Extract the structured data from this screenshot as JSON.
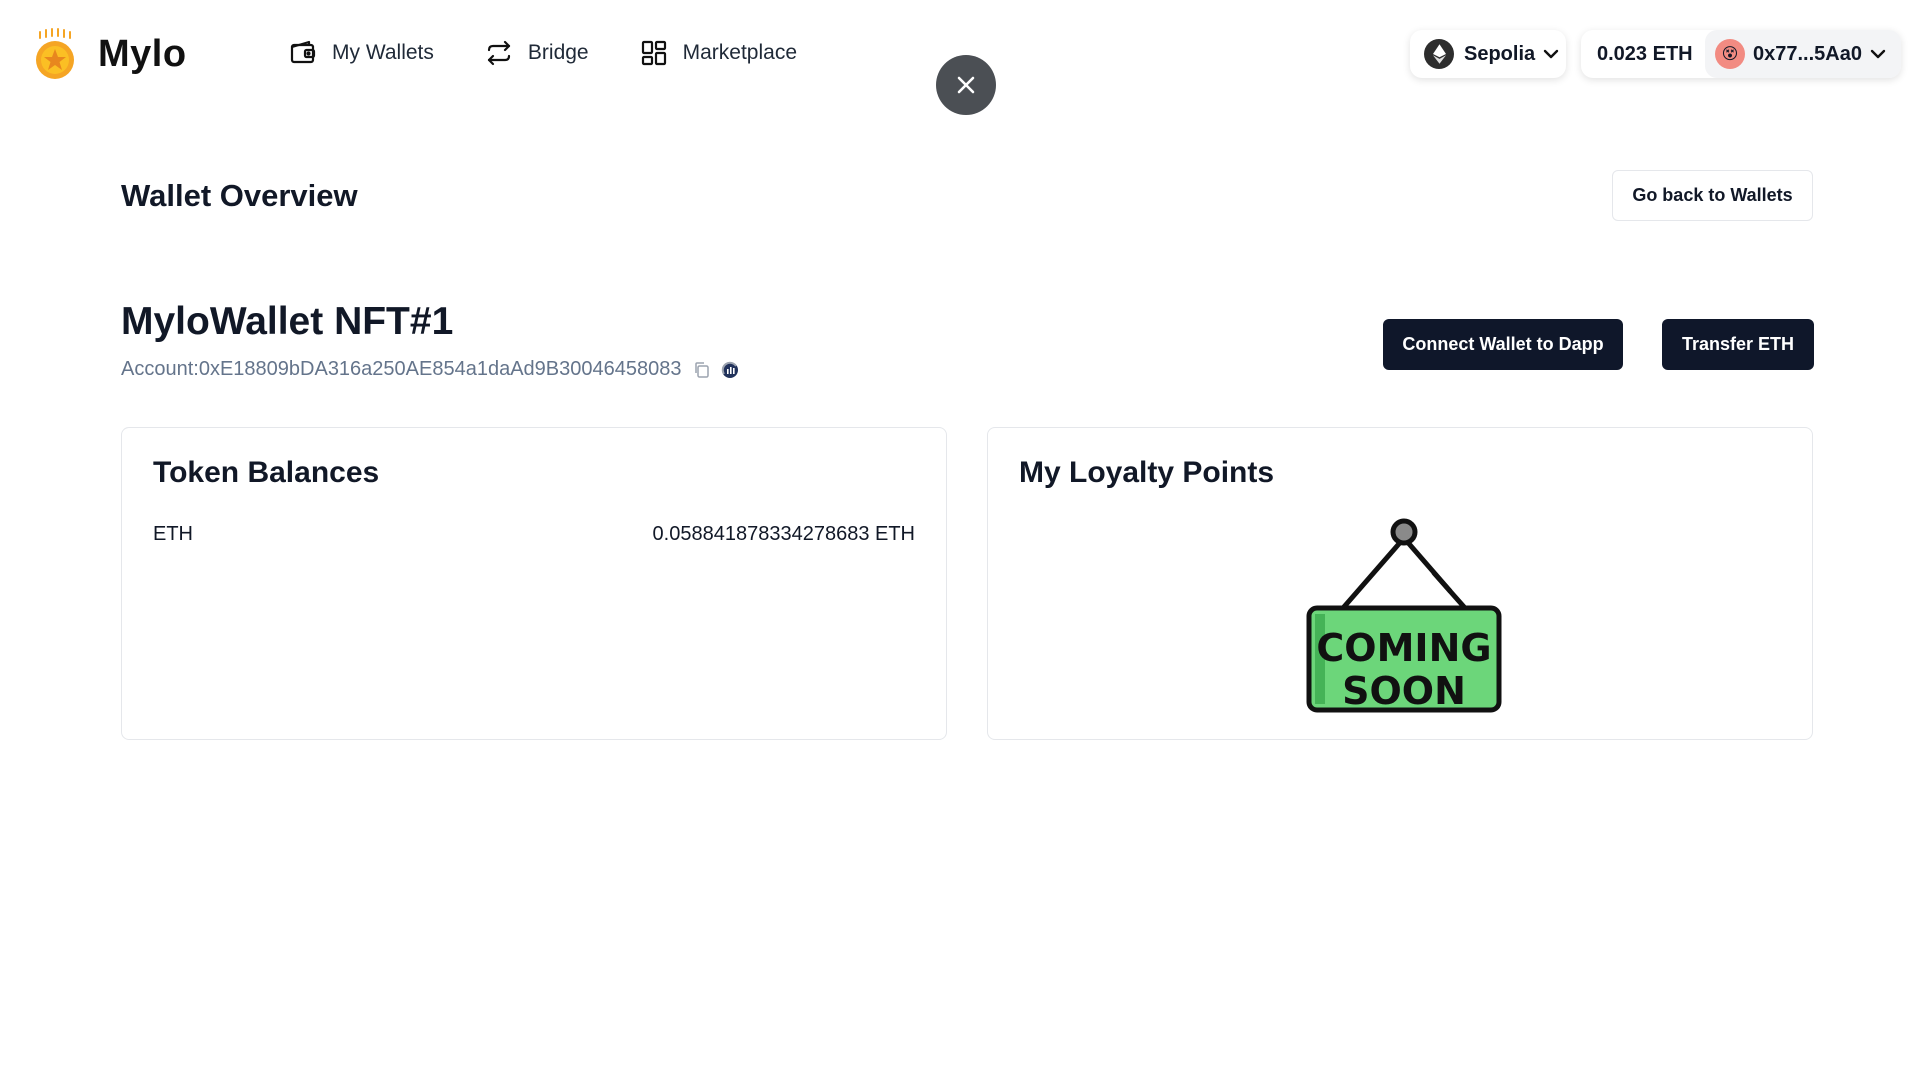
{
  "header": {
    "app_name": "Mylo",
    "nav": [
      {
        "label": "My Wallets",
        "icon": "wallet-icon"
      },
      {
        "label": "Bridge",
        "icon": "arrows-swap-icon"
      },
      {
        "label": "Marketplace",
        "icon": "grid-icon"
      }
    ],
    "network": {
      "name": "Sepolia",
      "icon": "ethereum-icon"
    },
    "account": {
      "balance": "0.023 ETH",
      "address": "0x77...5Aa0",
      "avatar_emoji": "😵"
    }
  },
  "page": {
    "title": "Wallet Overview",
    "back_button": "Go back to Wallets"
  },
  "wallet": {
    "name": "MyloWallet NFT#1",
    "account_label": "Account:",
    "account_address": "0xE18809bDA316a250AE854a1daAd9B30046458083",
    "connect_button": "Connect Wallet to Dapp",
    "transfer_button": "Transfer ETH"
  },
  "token_balances": {
    "title": "Token Balances",
    "rows": [
      {
        "symbol": "ETH",
        "amount": "0.058841878334278683 ETH"
      }
    ]
  },
  "loyalty": {
    "title": "My Loyalty Points",
    "sign_line1": "COMING",
    "sign_line2": "SOON"
  },
  "colors": {
    "primary_dark": "#0f172a",
    "close_button": "#4b4f54",
    "sign_green": "#6cd67a",
    "logo_gold": "#f5a524"
  }
}
